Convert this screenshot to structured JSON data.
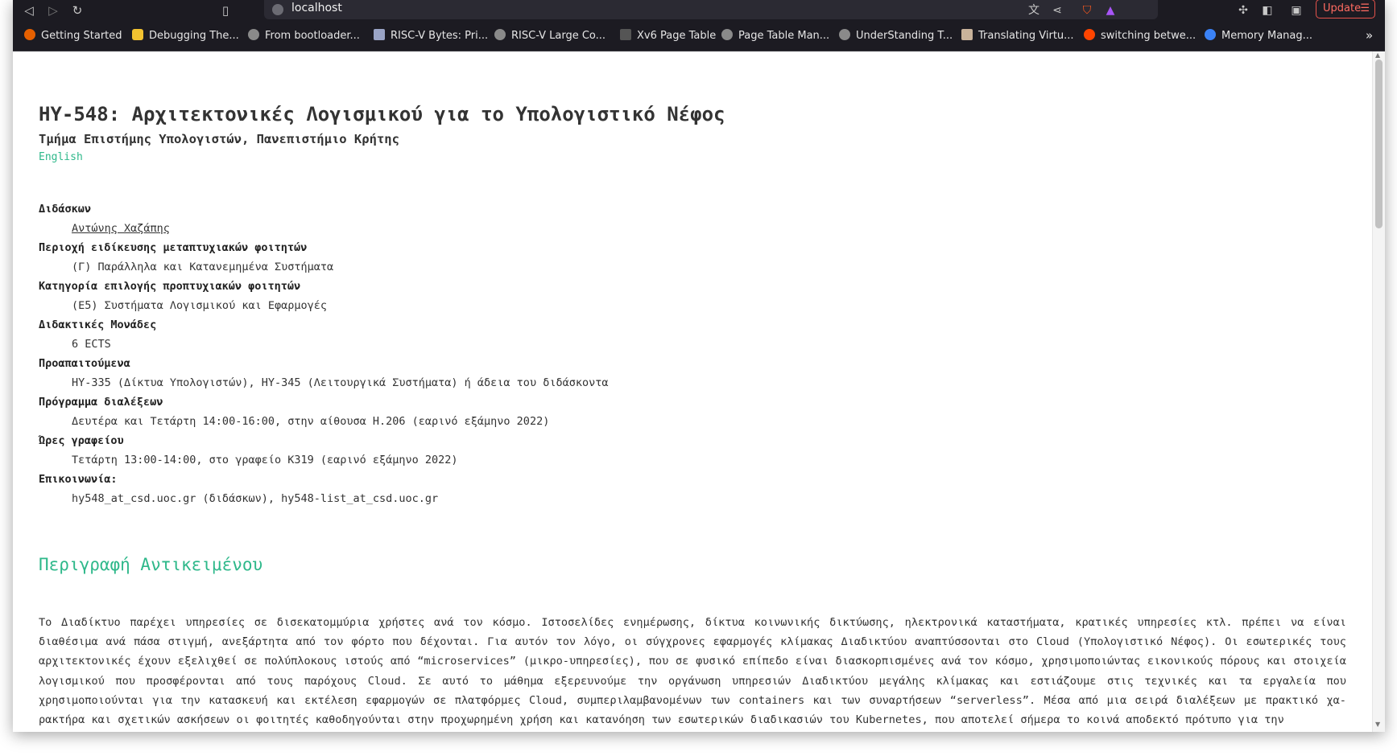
{
  "browser": {
    "url": "localhost",
    "update_label": "Update",
    "bookmarks": [
      {
        "label": "Getting Started",
        "icon": "firefox-icon",
        "color": "#e66000"
      },
      {
        "label": "Debugging The...",
        "icon": "tux-icon",
        "color": "#f2c230"
      },
      {
        "label": "From bootloader...",
        "icon": "globe-icon",
        "color": "#8a8a8a"
      },
      {
        "label": "RISC-V Bytes: Pri...",
        "icon": "floppy-icon",
        "color": "#9aa4c6"
      },
      {
        "label": "RISC-V Large Co...",
        "icon": "globe-icon",
        "color": "#8a8a8a"
      },
      {
        "label": "Xv6 Page Table",
        "icon": "chess-icon",
        "color": "#555555"
      },
      {
        "label": "Page Table Man...",
        "icon": "globe-icon",
        "color": "#8a8a8a"
      },
      {
        "label": "UnderStanding T...",
        "icon": "globe-icon",
        "color": "#8a8a8a"
      },
      {
        "label": "Translating Virtu...",
        "icon": "image-icon",
        "color": "#c8b29a"
      },
      {
        "label": "switching betwe...",
        "icon": "reddit-icon",
        "color": "#ff4500"
      },
      {
        "label": "Memory Manag...",
        "icon": "os-icon",
        "color": "#3b82f6"
      }
    ]
  },
  "page": {
    "title": "HY-548: Αρχιτεκτονικές Λογισμικού για το Υπολογιστικό Νέφος",
    "subtitle": "Τμήμα Επιστήμης Υπολογιστών, Πανεπιστήμιο Κρήτης",
    "language_link": "English",
    "info": [
      {
        "term": "Διδάσκων",
        "value": "Αντώνης Χαζάπης",
        "link": true
      },
      {
        "term": "Περιοχή ειδίκευσης μεταπτυχιακών φοιτητών",
        "value": "(Γ) Παράλληλα και Κατανεμημένα Συστήματα",
        "link": false
      },
      {
        "term": "Κατηγορία επιλογής προπτυχιακών φοιτητών",
        "value": "(Ε5) Συστήματα Λογισμικού και Εφαρμογές",
        "link": false
      },
      {
        "term": "Διδακτικές Μονάδες",
        "value": "6 ECTS",
        "link": false
      },
      {
        "term": "Προαπαιτούμενα",
        "value": "HY-335 (Δίκτυα Υπολογιστών), HY-345 (Λειτουργικά Συστήματα) ή άδεια του διδάσκοντα",
        "link": false
      },
      {
        "term": "Πρόγραμμα διαλέξεων",
        "value": "Δευτέρα και Τετάρτη 14:00-16:00, στην αίθουσα H.206 (εαρινό εξάμηνο 2022)",
        "link": false
      },
      {
        "term": "Ώρες γραφείου",
        "value": "Τετάρτη 13:00-14:00, στο γραφείο Κ319 (εαρινό εξάμηνο 2022)",
        "link": false
      },
      {
        "term": "Επικοινωνία:",
        "value": "hy548_at_csd.uoc.gr (διδάσκων), hy548-list_at_csd.uoc.gr",
        "link": false
      }
    ],
    "section_title": "Περιγραφή Αντικειμένου",
    "description": "Το Διαδίκτυο παρέχει υπηρεσίες σε δισεκατομμύρια χρήστες ανά τον κόσμο. Ιστοσελίδες ενημέρωσης, δίκτυα κοινωνικής δικτύωσης, ηλεκτρονικά καταστήματα, κρατικές υπηρεσίες κτλ. πρέπει να είναι διαθέσιμα ανά πάσα στιγμή, ανεξάρτητα από τον φόρτο που δέχονται. Για αυτόν τον λόγο, οι σύγχρονες εφαρμογές κλίμακας Διαδικτύου αναπτύσσονται στο Cloud (Υπολογιστικό Νέφος). Οι εσωτερικές τους αρχιτεκτονικές έχουν εξελιχθεί σε πολύπλοκους ιστούς από “microservices” (μικρο-υπηρεσίες), που σε φυσικό επίπεδο είναι διασκορπισμένες ανά τον κόσμο, χρησιμοποιώντας εικονικούς πόρους και στοιχεία λογισμικού που προσφέρονται από τους παρόχους Cloud. Σε αυτό το μάθημα εξερευνούμε την οργάνωση υπηρεσιών Διαδικτύου μεγάλης κλίμακας και εστιάζουμε στις τεχνικές και τα εργαλεία που χρησιμοποιούνται για την κατασκευή και εκτέλεση εφαρμογών σε πλατφόρμες Cloud, συμπεριλαμβανομένων των containers και των συναρτήσεων “serverless”. Μέσα από μια σειρά διαλέξεων με πρακτικό χα-ρακτήρα και σχετικών ασκήσεων οι φοιτητές καθοδηγούνται στην προχωρημένη χρήση και κατανόηση των εσωτερικών διαδικασιών του Kubernetes, που αποτελεί σήμερα το κοινά αποδεκτό πρότυπο για την"
  }
}
